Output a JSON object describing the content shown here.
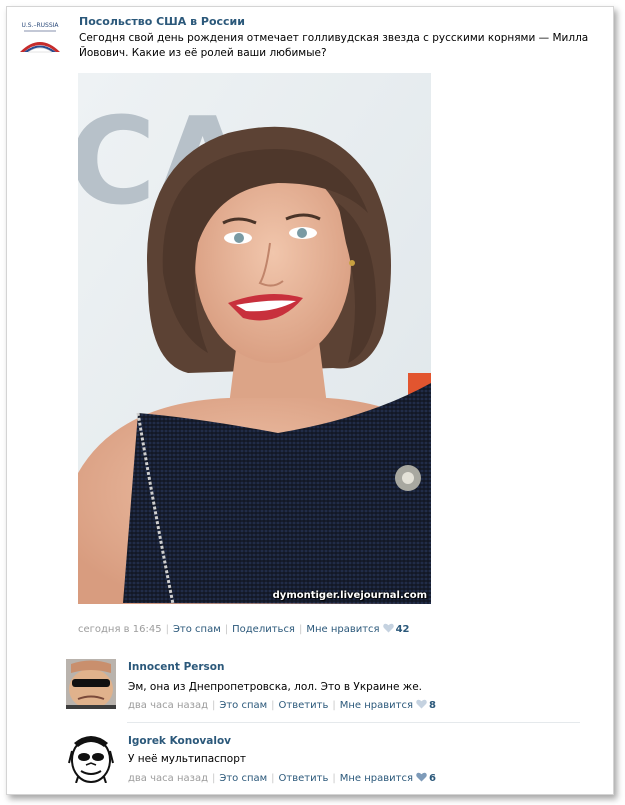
{
  "post": {
    "author": "Посольство США в России",
    "avatar_label": "U.S.–RUSSIA",
    "text": "Сегодня свой день рождения отмечает голливудская звезда с русскими корнями — Милла Йовович. Какие из её ролей ваши любимые?",
    "photo": {
      "watermark": "dymontiger.livejournal.com",
      "background_lettering": "CA"
    },
    "meta": {
      "time": "сегодня в 16:45",
      "spam": "Это спам",
      "share": "Поделиться",
      "like": "Мне нравится",
      "likes_count": "42"
    }
  },
  "comments": [
    {
      "author": "Innocent Person",
      "text": "Эм, она из Днепропетровска, лол. Это в Украине же.",
      "time": "два часа назад",
      "spam": "Это спам",
      "reply": "Ответить",
      "like": "Мне нравится",
      "likes_count": "8"
    },
    {
      "author": "Igorek Konovalov",
      "text": "У неё мультипаспорт",
      "time": "два часа назад",
      "spam": "Это спам",
      "reply": "Ответить",
      "like": "Мне нравится",
      "likes_count": "6"
    }
  ],
  "colors": {
    "link": "#2b587a",
    "meta": "#9c9c9c",
    "heart": "#7e9bb9"
  }
}
